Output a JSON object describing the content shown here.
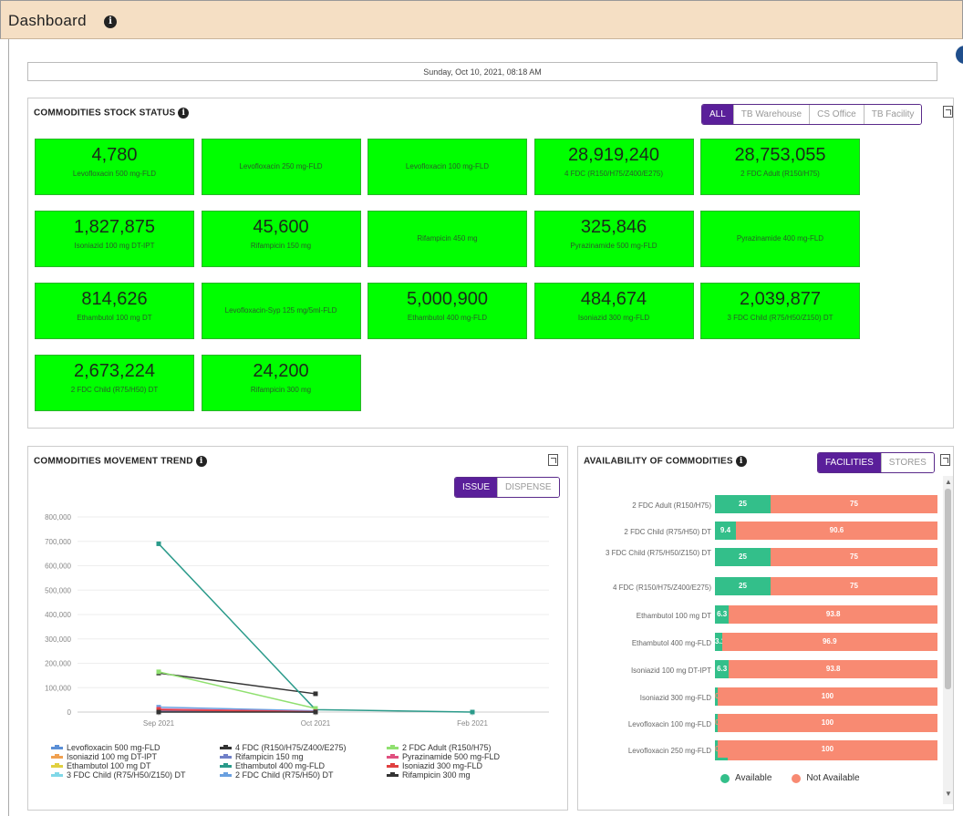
{
  "header": {
    "title": "Dashboard",
    "info_icon": "info-circle-icon"
  },
  "datetime": "Sunday, Oct 10, 2021, 08:18 AM",
  "stock_status": {
    "title": "COMMODITIES STOCK STATUS",
    "filters": [
      "ALL",
      "TB Warehouse",
      "CS Office",
      "TB Facility"
    ],
    "active_filter": "ALL",
    "tile_color": "#00ff00",
    "tiles": [
      {
        "value": "4,780",
        "name": "Levofloxacin 500 mg-FLD"
      },
      {
        "value": "",
        "name": "Levofloxacin 250 mg-FLD"
      },
      {
        "value": "",
        "name": "Levofloxacin 100 mg-FLD"
      },
      {
        "value": "28,919,240",
        "name": "4 FDC (R150/H75/Z400/E275)"
      },
      {
        "value": "28,753,055",
        "name": "2 FDC Adult (R150/H75)"
      },
      {
        "value": "1,827,875",
        "name": "Isoniazid 100 mg DT-IPT"
      },
      {
        "value": "45,600",
        "name": "Rifampicin 150 mg"
      },
      {
        "value": "",
        "name": "Rifampicin 450 mg"
      },
      {
        "value": "325,846",
        "name": "Pyrazinamide 500 mg-FLD"
      },
      {
        "value": "",
        "name": "Pyrazinamide 400 mg-FLD"
      },
      {
        "value": "814,626",
        "name": "Ethambutol 100 mg DT"
      },
      {
        "value": "",
        "name": "Levofloxacin-Syp 125 mg/5ml-FLD"
      },
      {
        "value": "5,000,900",
        "name": "Ethambutol 400 mg-FLD"
      },
      {
        "value": "484,674",
        "name": "Isoniazid 300 mg-FLD"
      },
      {
        "value": "2,039,877",
        "name": "3 FDC Child (R75/H50/Z150) DT"
      },
      {
        "value": "2,673,224",
        "name": "2 FDC Child (R75/H50) DT"
      },
      {
        "value": "24,200",
        "name": "Rifampicin 300 mg"
      }
    ]
  },
  "movement": {
    "title": "COMMODITIES MOVEMENT TREND",
    "toggle": [
      "ISSUE",
      "DISPENSE"
    ],
    "active_toggle": "ISSUE",
    "chart_data": {
      "type": "line",
      "categories": [
        "Sep 2021",
        "Oct 2021",
        "Feb 2021"
      ],
      "ylim": [
        0,
        800000
      ],
      "yticks": [
        "0",
        "100,000",
        "200,000",
        "300,000",
        "400,000",
        "500,000",
        "600,000",
        "700,000",
        "800,000"
      ],
      "grid": true,
      "legend_position": "bottom",
      "series": [
        {
          "name": "Levofloxacin 500 mg-FLD",
          "color": "#5b8fd6",
          "values": [
            5000,
            0,
            null
          ]
        },
        {
          "name": "Isoniazid 100 mg DT-IPT",
          "color": "#f0a050",
          "values": [
            8000,
            2000,
            null
          ]
        },
        {
          "name": "Ethambutol 100 mg DT",
          "color": "#e0d040",
          "values": [
            6000,
            1000,
            null
          ]
        },
        {
          "name": "3 FDC Child (R75/H50/Z150) DT",
          "color": "#80d8e8",
          "values": [
            10000,
            3000,
            null
          ]
        },
        {
          "name": "4 FDC (R150/H75/Z400/E275)",
          "color": "#333333",
          "values": [
            160000,
            75000,
            null
          ]
        },
        {
          "name": "Rifampicin 150 mg",
          "color": "#7080c8",
          "values": [
            4000,
            0,
            null
          ]
        },
        {
          "name": "Ethambutol 400 mg-FLD",
          "color": "#2a9a8a",
          "values": [
            690000,
            10000,
            0
          ]
        },
        {
          "name": "2 FDC Child (R75/H50) DT",
          "color": "#6aa0e0",
          "values": [
            20000,
            5000,
            null
          ]
        },
        {
          "name": "2 FDC Adult (R150/H75)",
          "color": "#90e070",
          "values": [
            165000,
            15000,
            null
          ]
        },
        {
          "name": "Pyrazinamide 500 mg-FLD",
          "color": "#e05080",
          "values": [
            12000,
            2000,
            null
          ]
        },
        {
          "name": "Isoniazid 300 mg-FLD",
          "color": "#e04040",
          "values": [
            9000,
            1000,
            null
          ]
        },
        {
          "name": "Rifampicin 300 mg",
          "color": "#333333",
          "values": [
            0,
            0,
            null
          ]
        }
      ]
    }
  },
  "availability": {
    "title": "AVAILABILITY OF COMMODITIES",
    "toggle": [
      "FACILITIES",
      "STORES"
    ],
    "active_toggle": "FACILITIES",
    "chart_data": {
      "type": "bar",
      "orientation": "horizontal-stacked",
      "categories": [
        "2 FDC Adult (R150/H75)",
        "2 FDC Child (R75/H50) DT",
        "3 FDC Child (R75/H50/Z150) DT",
        "4 FDC (R150/H75/Z400/E275)",
        "Ethambutol 100 mg DT",
        "Ethambutol 400 mg-FLD",
        "Isoniazid 100 mg DT-IPT",
        "Isoniazid 300 mg-FLD",
        "Levofloxacin 100 mg-FLD",
        "Levofloxacin 250 mg-FLD"
      ],
      "series": [
        {
          "name": "Available",
          "color": "#33bf8a",
          "values": [
            25,
            9.4,
            25,
            25,
            6.3,
            3.1,
            6.3,
            0,
            0,
            0
          ],
          "labels": [
            "25",
            "9.4",
            "25",
            "25",
            "6.3",
            "3.1",
            "6.3",
            "0",
            "0",
            "0"
          ]
        },
        {
          "name": "Not Available",
          "color": "#f88a72",
          "values": [
            75,
            90.6,
            75,
            75,
            93.8,
            96.9,
            93.8,
            100,
            100,
            100
          ],
          "labels": [
            "75",
            "90.6",
            "75",
            "75",
            "93.8",
            "96.9",
            "93.8",
            "100",
            "100",
            "100"
          ]
        }
      ],
      "legend_position": "bottom"
    }
  }
}
